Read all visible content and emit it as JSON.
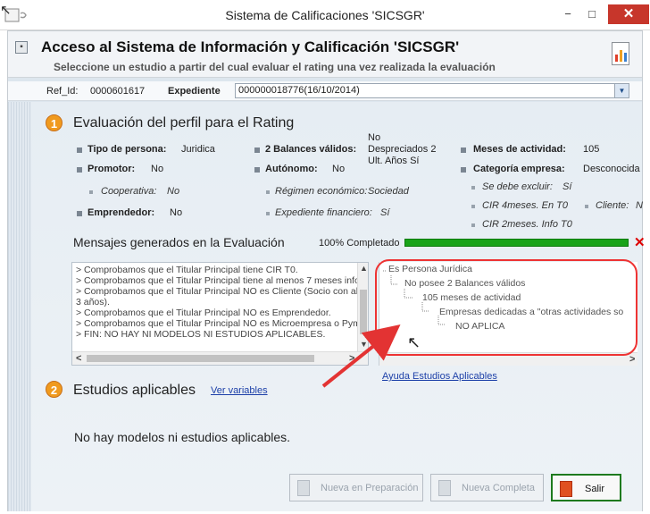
{
  "window": {
    "title": "Sistema de Calificaciones 'SICSGR'",
    "minimize_glyph": "−",
    "maximize_glyph": "□",
    "close_glyph": "✕"
  },
  "header": {
    "collapse_glyph": "▪",
    "title": "Acceso al Sistema de Información y Calificación 'SICSGR'",
    "subtitle": "Seleccione un estudio a partir del cual evaluar el rating una vez realizada la evaluación",
    "report_icon": "bar-chart-report-icon"
  },
  "ref_row": {
    "ref_label": "Ref_Id:",
    "ref_value": "0000601617",
    "expediente_label": "Expediente",
    "expediente_value": "000000018776(16/10/2014)"
  },
  "section1": {
    "badge": "1",
    "title": "Evaluación del perfil para el Rating",
    "fields": {
      "tipo_label": "Tipo de persona:",
      "tipo_value": "Juridica",
      "balances_label": "2 Balances válidos:",
      "balances_value_1": "No",
      "balances_value_2": "Despreciados 2",
      "balances_value_3": "Ult. Años Sí",
      "meses_label": "Meses de actividad:",
      "meses_value": "105",
      "promotor_label": "Promotor:",
      "promotor_value": "No",
      "autonomo_label": "Autónomo:",
      "autonomo_value": "No",
      "categoria_label": "Categoría empresa:",
      "categoria_value": "Desconocida",
      "cooperativa_label": "Cooperativa:",
      "cooperativa_value": "No",
      "regimen_label": "Régimen económico:",
      "regimen_value": "Sociedad",
      "excluir_label": "Se debe excluir:",
      "excluir_value": "Sí",
      "emprendedor_label": "Emprendedor:",
      "emprendedor_value": "No",
      "financiero_label": "Expediente financiero:",
      "financiero_value": "Sí",
      "cir4_label": "CIR 4meses. En T0",
      "cliente_label": "Cliente:",
      "cliente_value": "N",
      "cir2_label": "CIR 2meses. Info T0"
    }
  },
  "messages": {
    "title": "Mensajes generados en la Evaluación",
    "progress_text": "100% Completado",
    "progress": 1.0,
    "cancel_glyph": "✕",
    "log": [
      "> Comprobamos que el Titular Principal tiene CIR T0.",
      "> Comprobamos que el Titular Principal tiene al menos 7 meses infor",
      "> Comprobamos que el Titular Principal NO es Cliente (Socio con alg",
      "3 años).",
      "> Comprobamos que el Titular Principal NO es Emprendedor.",
      "> Comprobamos que el Titular Principal NO es Microempresa o Pym",
      "> FIN: NO HAY NI MODELOS NI ESTUDIOS APLICABLES."
    ],
    "tree": [
      "Es Persona Jurídica",
      "No posee 2 Balances válidos",
      "105 meses de actividad",
      "Empresas dedicadas a \"otras actividades so",
      "NO APLICA"
    ],
    "help_link": "Ayuda Estudios Aplicables",
    "scroll_up": "▲",
    "scroll_down": "▼",
    "scroll_left": "<",
    "scroll_right": ">"
  },
  "section2": {
    "badge": "2",
    "title": "Estudios aplicables",
    "link": "Ver variables",
    "empty_text": "No hay modelos ni estudios aplicables."
  },
  "buttons": {
    "nueva_preparacion": "Nueva en Preparación",
    "nueva_completa": "Nueva Completa",
    "salir": "Salir"
  },
  "colors": {
    "accent_orange": "#f09a1e",
    "progress_green": "#19a319",
    "annotation_red": "#e33333",
    "link_blue": "#1c3fa8"
  }
}
